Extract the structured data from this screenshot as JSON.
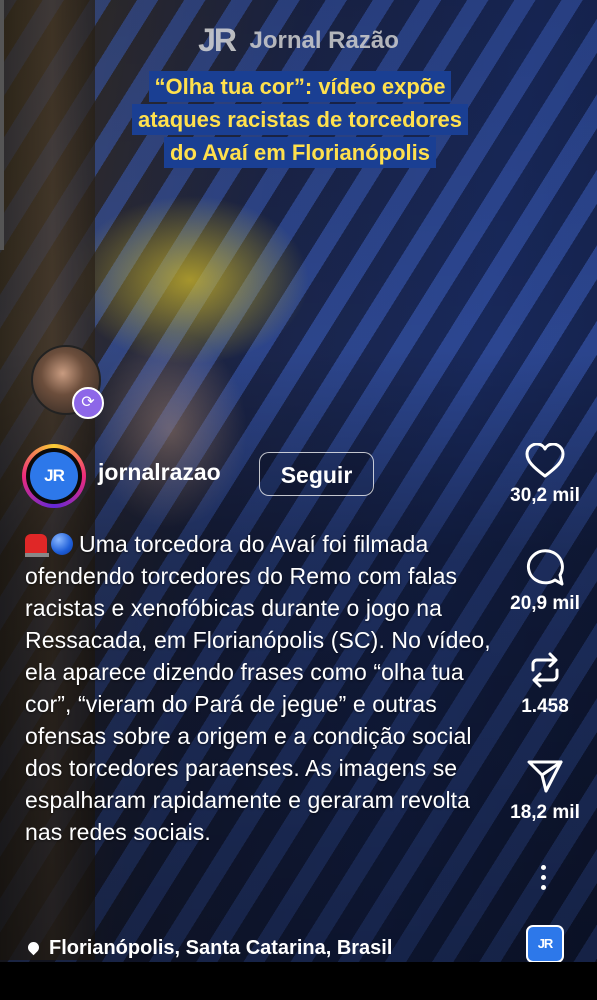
{
  "video": {
    "brand_logo": "JR",
    "brand_name": "Jornal Razão",
    "headline": [
      "“Olha tua cor”: vídeo expõe",
      "ataques racistas de torcedores",
      "do Avaí em Florianópolis"
    ]
  },
  "post": {
    "profile_logo": "JR",
    "username": "jornalrazao",
    "follow_label": "Seguir",
    "caption_emojis": [
      "siren",
      "blue-circle"
    ],
    "caption": "Uma torcedora do Avaí foi filmada ofendendo torcedores do Remo com falas racistas e xenofóbicas durante o jogo na Ressacada, em Florianópolis (SC). No vídeo, ela aparece dizendo frases como “olha tua cor”, “vieram do Pará de jegue” e outras ofensas sobre a origem e a condição social dos torcedores paraenses. As imagens se espalharam rapidamente e geraram revolta nas redes sociais.",
    "location": "Florianópolis, Santa Catarina, Brasil"
  },
  "actions": {
    "likes": "30,2 mil",
    "comments": "20,9 mil",
    "reposts": "1.458",
    "shares": "18,2 mil",
    "icons": [
      "heart-icon",
      "comment-icon",
      "repost-icon",
      "send-icon",
      "more-icon"
    ]
  },
  "audio": {
    "thumb_label": "JR"
  },
  "colors": {
    "headline_bg": "#1a3f93",
    "headline_text": "#ffe04d",
    "profile_blue": "#2d78ea",
    "remix_badge": "#8d67e8"
  }
}
